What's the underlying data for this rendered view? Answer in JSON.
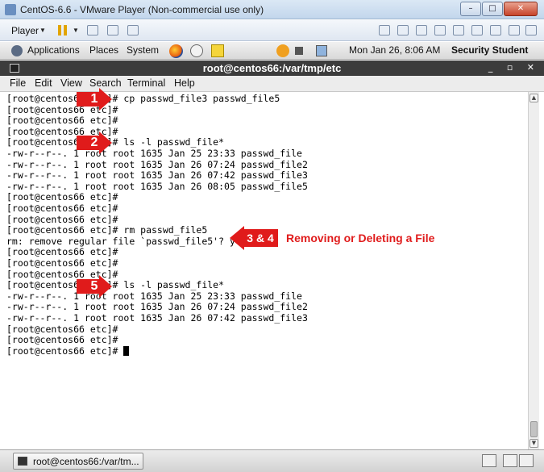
{
  "vmware": {
    "title": "CentOS-6.6 - VMware Player (Non-commercial use only)",
    "controls": {
      "minimize": "–",
      "maximize": "□",
      "close": "✕"
    },
    "toolbar": {
      "player_menu": "Player",
      "dropdown": "▼"
    }
  },
  "gnome_panel": {
    "applications": "Applications",
    "places": "Places",
    "system": "System",
    "clock": "Mon Jan 26,  8:06 AM",
    "user": "Security Student"
  },
  "terminal": {
    "title": "root@centos66:/var/tmp/etc",
    "window_controls": {
      "minimize": "_",
      "maximize": "▫",
      "close": "✕"
    },
    "menu": [
      "File",
      "Edit",
      "View",
      "Search",
      "Terminal",
      "Help"
    ],
    "lines": [
      "[root@centos66 etc]# cp passwd_file3 passwd_file5",
      "[root@centos66 etc]#",
      "[root@centos66 etc]#",
      "[root@centos66 etc]#",
      "[root@centos66 etc]# ls -l passwd_file*",
      "-rw-r--r--. 1 root root 1635 Jan 25 23:33 passwd_file",
      "-rw-r--r--. 1 root root 1635 Jan 26 07:24 passwd_file2",
      "-rw-r--r--. 1 root root 1635 Jan 26 07:42 passwd_file3",
      "-rw-r--r--. 1 root root 1635 Jan 26 08:05 passwd_file5",
      "[root@centos66 etc]#",
      "[root@centos66 etc]#",
      "[root@centos66 etc]#",
      "[root@centos66 etc]# rm passwd_file5",
      "rm: remove regular file `passwd_file5'? y",
      "[root@centos66 etc]#",
      "[root@centos66 etc]#",
      "[root@centos66 etc]#",
      "[root@centos66 etc]# ls -l passwd_file*",
      "-rw-r--r--. 1 root root 1635 Jan 25 23:33 passwd_file",
      "-rw-r--r--. 1 root root 1635 Jan 26 07:24 passwd_file2",
      "-rw-r--r--. 1 root root 1635 Jan 26 07:42 passwd_file3",
      "[root@centos66 etc]#",
      "[root@centos66 etc]#",
      "[root@centos66 etc]# "
    ]
  },
  "taskbar": {
    "task_label": "root@centos66:/var/tm..."
  },
  "annotations": {
    "step1": "1",
    "step2": "2",
    "step34": "3 & 4",
    "step5": "5",
    "caption": "Removing or Deleting a File",
    "color": "#e01b1b"
  }
}
